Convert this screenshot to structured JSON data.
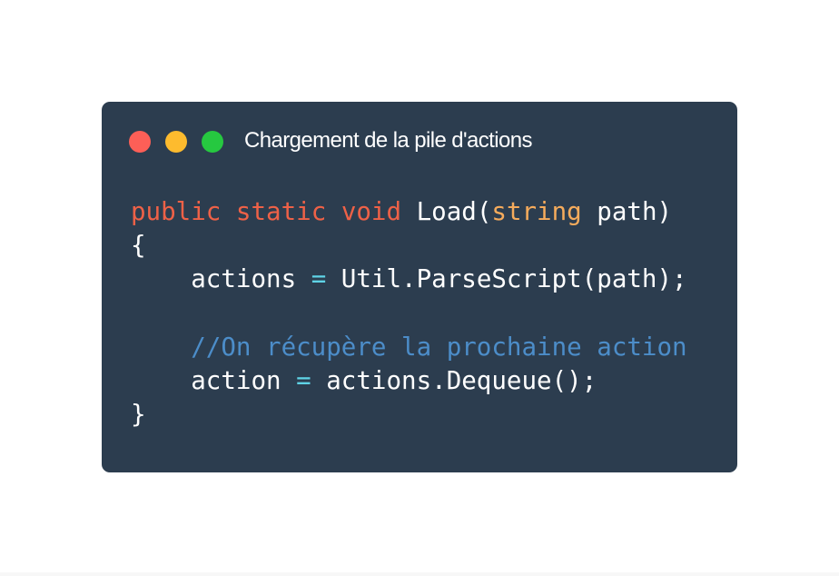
{
  "window": {
    "title": "Chargement de la pile d'actions",
    "background_color": "#2c3d4f",
    "buttons": {
      "close": {
        "icon": "close-dot-icon",
        "color": "#fd5f57"
      },
      "minimize": {
        "icon": "minimize-dot-icon",
        "color": "#fdbb2e"
      },
      "zoom": {
        "icon": "zoom-dot-icon",
        "color": "#26c840"
      }
    }
  },
  "syntax_colors": {
    "keyword": "#ee6147",
    "type": "#f5ab5c",
    "operator": "#5fd3e6",
    "comment": "#4c8dc9",
    "plain": "#ffffff"
  },
  "code": {
    "lines": [
      {
        "tokens": [
          {
            "text": "public",
            "kind": "kw"
          },
          {
            "text": " ",
            "kind": "plain"
          },
          {
            "text": "static",
            "kind": "kw"
          },
          {
            "text": " ",
            "kind": "plain"
          },
          {
            "text": "void",
            "kind": "kw"
          },
          {
            "text": " Load(",
            "kind": "plain"
          },
          {
            "text": "string",
            "kind": "type"
          },
          {
            "text": " path)",
            "kind": "plain"
          }
        ]
      },
      {
        "tokens": [
          {
            "text": "{",
            "kind": "plain"
          }
        ]
      },
      {
        "tokens": [
          {
            "text": "    actions ",
            "kind": "plain"
          },
          {
            "text": "=",
            "kind": "op"
          },
          {
            "text": " Util.ParseScript(path);",
            "kind": "plain"
          }
        ]
      },
      {
        "tokens": [
          {
            "text": "",
            "kind": "plain"
          }
        ]
      },
      {
        "tokens": [
          {
            "text": "    ",
            "kind": "plain"
          },
          {
            "text": "//On récupère la prochaine action",
            "kind": "comment"
          }
        ]
      },
      {
        "tokens": [
          {
            "text": "    action ",
            "kind": "plain"
          },
          {
            "text": "=",
            "kind": "op"
          },
          {
            "text": " actions.Dequeue();",
            "kind": "plain"
          }
        ]
      },
      {
        "tokens": [
          {
            "text": "}",
            "kind": "plain"
          }
        ]
      }
    ]
  }
}
